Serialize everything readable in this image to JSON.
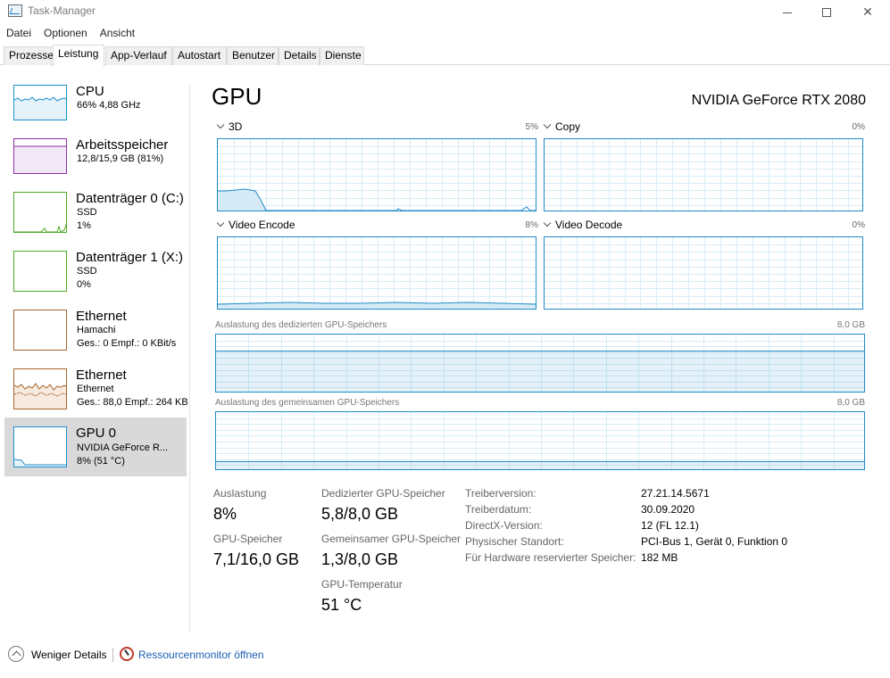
{
  "window": {
    "title": "Task-Manager"
  },
  "menu": [
    "Datei",
    "Optionen",
    "Ansicht"
  ],
  "tabs": [
    "Prozesse",
    "Leistung",
    "App-Verlauf",
    "Autostart",
    "Benutzer",
    "Details",
    "Dienste"
  ],
  "active_tab": "Leistung",
  "sidebar": [
    {
      "name": "CPU",
      "line1": "66% 4,88 GHz",
      "line2": "",
      "color": "#1b8fcb"
    },
    {
      "name": "Arbeitsspeicher",
      "line1": "12,8/15,9 GB (81%)",
      "line2": "",
      "color": "#8a2fa7"
    },
    {
      "name": "Datenträger 0 (C:)",
      "line1": "SSD",
      "line2": "1%",
      "color": "#4da924"
    },
    {
      "name": "Datenträger 1 (X:)",
      "line1": "SSD",
      "line2": "0%",
      "color": "#4da924"
    },
    {
      "name": "Ethernet",
      "line1": "Hamachi",
      "line2": "Ges.: 0 Empf.: 0 KBit/s",
      "color": "#a7642a"
    },
    {
      "name": "Ethernet",
      "line1": "Ethernet",
      "line2": "Ges.: 88,0 Empf.: 264 KB",
      "color": "#a7642a"
    },
    {
      "name": "GPU 0",
      "line1": "NVIDIA GeForce R...",
      "line2": "8% (51 °C)",
      "color": "#1b8fcb"
    }
  ],
  "main": {
    "title": "GPU",
    "model": "NVIDIA GeForce RTX 2080",
    "graphs": [
      {
        "label": "3D",
        "pct": "5%"
      },
      {
        "label": "Copy",
        "pct": "0%"
      },
      {
        "label": "Video Encode",
        "pct": "8%"
      },
      {
        "label": "Video Decode",
        "pct": "0%"
      }
    ],
    "dedicated_mem_label": "Auslastung des dedizierten GPU-Speichers",
    "dedicated_mem_max": "8,0 GB",
    "shared_mem_label": "Auslastung des gemeinsamen GPU-Speichers",
    "shared_mem_max": "8,0 GB",
    "dedicated_mem_fraction": 0.725,
    "shared_mem_fraction": 0.1625
  },
  "stats": {
    "auslastung_label": "Auslastung",
    "auslastung_value": "8%",
    "gpu_speicher_label": "GPU-Speicher",
    "gpu_speicher_value": "7,1/16,0 GB",
    "dedicated_label": "Dedizierter GPU-Speicher",
    "dedicated_value": "5,8/8,0 GB",
    "shared_label": "Gemeinsamer GPU-Speicher",
    "shared_value": "1,3/8,0 GB",
    "temp_label": "GPU-Temperatur",
    "temp_value": "51 °C"
  },
  "info": [
    {
      "key": "Treiberversion:",
      "value": "27.21.14.5671"
    },
    {
      "key": "Treiberdatum:",
      "value": "30.09.2020"
    },
    {
      "key": "DirectX-Version:",
      "value": "12 (FL 12.1)"
    },
    {
      "key": "Physischer Standort:",
      "value": "PCI-Bus 1, Gerät 0, Funktion 0"
    },
    {
      "key": "Für Hardware reservierter Speicher:",
      "value": "182 MB"
    }
  ],
  "footer": {
    "fewer_details": "Weniger Details",
    "resource_monitor": "Ressourcenmonitor öffnen"
  },
  "colors": {
    "gpu_accent": "#1f8ac9",
    "link": "#1a5fb4"
  }
}
